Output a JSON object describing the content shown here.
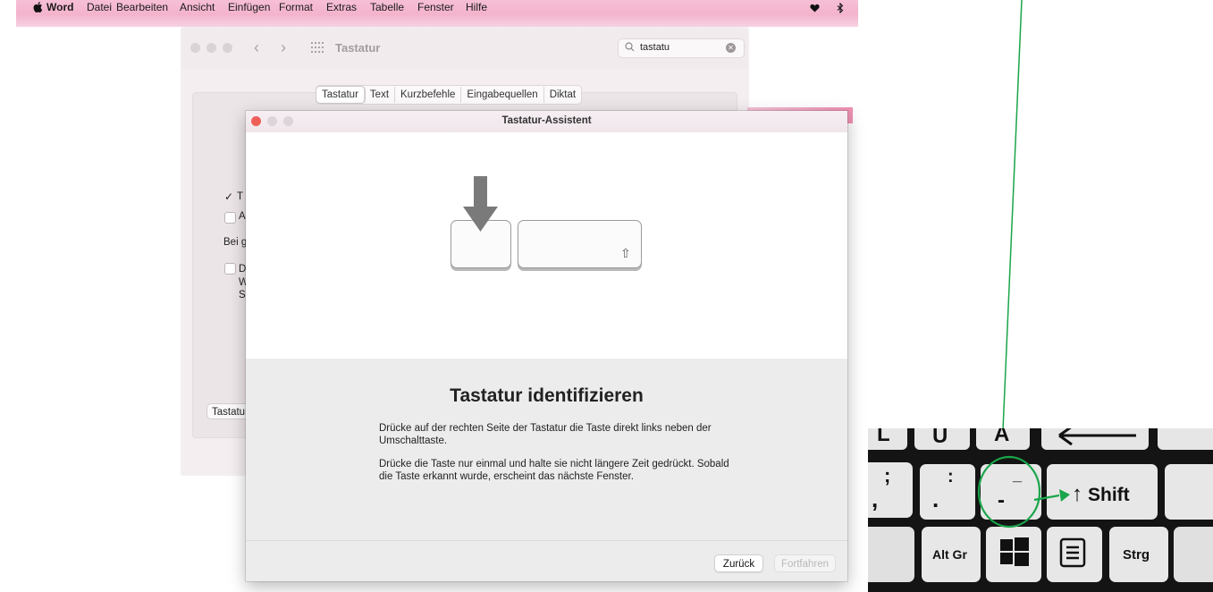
{
  "menubar": {
    "items": [
      "Word",
      "Datei",
      "Bearbeiten",
      "Ansicht",
      "Einfügen",
      "Format",
      "Extras",
      "Tabelle",
      "Fenster",
      "Hilfe"
    ],
    "right_icons": [
      "heart-icon",
      "bluetooth-icon"
    ]
  },
  "prefs_window": {
    "title": "Tastatur",
    "search_value": "tastatu",
    "tabs": [
      "Tastatur",
      "Text",
      "Kurzbefehle",
      "Eingabequellen",
      "Diktat"
    ],
    "selected_tab": "Tastatur",
    "fragments": {
      "check1": "✓",
      "t1": "T",
      "t2": "A",
      "t3": "Bei g",
      "t4": "D",
      "t5": "W",
      "t6": "S",
      "bottom_button": "Tastatur"
    }
  },
  "dialog": {
    "title": "Tastatur-Assistent",
    "heading": "Tastatur identifizieren",
    "para1": "Drücke auf der rechten Seite der Tastatur die Taste direkt links neben der Umschalttaste.",
    "para2": "Drücke die Taste nur einmal und halte sie nicht längere Zeit gedrückt. Sobald die Taste erkannt wurde, erscheint das nächste Fenster.",
    "back_button": "Zurück",
    "next_button": "Fortfahren",
    "shift_glyph": "⇧"
  },
  "keyboard_photo": {
    "keys": {
      "key_l": "L",
      "key_u": "U",
      "key_a": "A",
      "key_semicolon_top": ";",
      "key_semicolon_bottom": ",",
      "key_colon_top": ":",
      "key_colon_bottom": ".",
      "key_underscore_top": "_",
      "key_underscore_bottom": "-",
      "key_shift_arrow": "↑",
      "key_shift": "Shift",
      "key_altgr": "Alt Gr",
      "key_strg": "Strg"
    }
  },
  "colors": {
    "menubar": "#f3b3cc",
    "annotation_green": "#1aa54a",
    "close_red": "#ee5f58"
  }
}
